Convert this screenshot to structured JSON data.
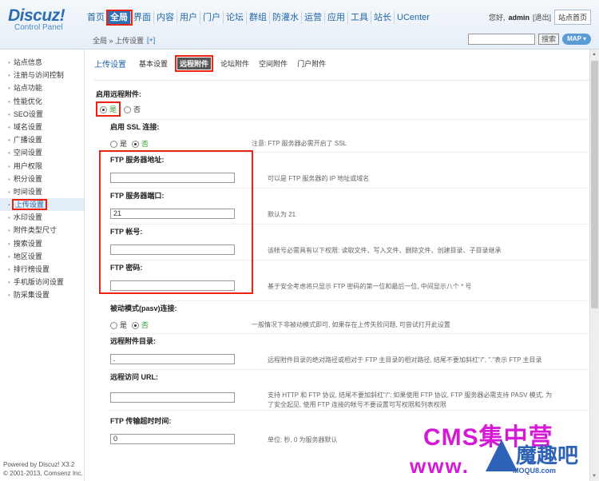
{
  "header": {
    "logo": "Discuz!",
    "logo_sub": "Control Panel",
    "nav": [
      "首页",
      "全局",
      "界面",
      "内容",
      "用户",
      "门户",
      "论坛",
      "群组",
      "防灌水",
      "运营",
      "应用",
      "工具",
      "站长",
      "UCenter"
    ],
    "greeting": "您好,",
    "username": "admin",
    "logout": "[退出]",
    "home_button": "站点首页",
    "breadcrumb": "全局 » 上传设置",
    "breadcrumb_add": "[+]",
    "search_button": "搜索",
    "map_button": "MAP ▾"
  },
  "sidebar": {
    "items": [
      "站点信息",
      "注册与访问控制",
      "站点功能",
      "性能优化",
      "SEO设置",
      "域名设置",
      "广播设置",
      "空间设置",
      "用户权限",
      "积分设置",
      "时间设置",
      "上传设置",
      "水印设置",
      "附件类型尺寸",
      "搜索设置",
      "地区设置",
      "排行榜设置",
      "手机版访问设置",
      "防采集设置"
    ],
    "active_index": 11,
    "powered": "Powered by Discuz! X3.2",
    "copyright": "© 2001-2013, Comsenz Inc."
  },
  "main": {
    "title": "上传设置",
    "tabs": [
      "基本设置",
      "远程附件",
      "论坛附件",
      "空间附件",
      "门户附件"
    ],
    "active_tab": 1,
    "enable_remote": {
      "label": "启用远程附件:",
      "yes": "是",
      "no": "否"
    },
    "ssl": {
      "label": "启用 SSL 连接:",
      "yes": "是",
      "no": "否",
      "hint": "注意: FTP 服务器必需开启了 SSL"
    },
    "ftp_host": {
      "label": "FTP 服务器地址:",
      "value": "",
      "hint": "可以是 FTP 服务器的 IP 地址或域名"
    },
    "ftp_port": {
      "label": "FTP 服务器端口:",
      "value": "21",
      "hint": "默认为 21"
    },
    "ftp_user": {
      "label": "FTP 帐号:",
      "value": "",
      "hint": "该帐号必需具有以下权限: 读取文件、写入文件、删除文件、创建目录、子目录继承"
    },
    "ftp_pass": {
      "label": "FTP 密码:",
      "value": "",
      "hint": "基于安全考虑将只显示 FTP 密码的第一位和最后一位, 中间显示八个 * 号"
    },
    "pasv": {
      "label": "被动模式(pasv)连接:",
      "yes": "是",
      "no": "否",
      "hint": "一般情况下非被动模式即可, 如果存在上传失败问题, 可尝试打开此设置"
    },
    "remote_dir": {
      "label": "远程附件目录:",
      "value": ".",
      "hint": "远程附件目录的绝对路径或相对于 FTP 主目录的相对路径, 结尾不要加斜杠\"/\", \".\"表示 FTP 主目录"
    },
    "remote_url": {
      "label": "远程访问 URL:",
      "value": "",
      "hint1": "支持 HTTP 和 FTP 协议, 结尾不要加斜杠\"/\"; 如果使用 FTP 协议, FTP 服务器必需支持 PASV 模式, 为",
      "hint2": "了安全起见, 使用 FTP 连接的帐号不要设置可写权限和列表权限"
    },
    "timeout": {
      "label": "FTP 传输超时时间:",
      "value": "0",
      "hint": "单位: 秒, 0 为服务器默认"
    }
  },
  "watermark": {
    "line1": "CMS集中营",
    "line2": "www.",
    "logo_text": "魔趣吧",
    "logo_url": "MOQU8.com"
  }
}
